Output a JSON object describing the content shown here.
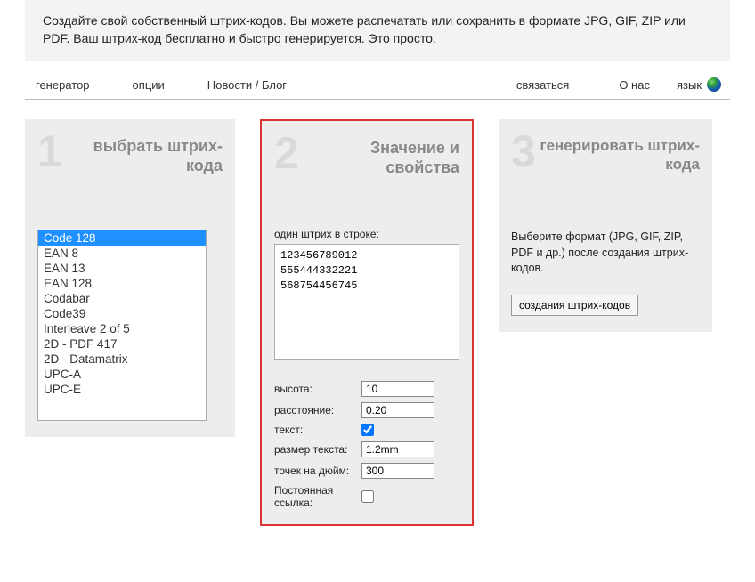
{
  "intro": "Создайте свой собственный штрих-кодов. Вы можете распечатать или сохранить в формате JPG, GIF, ZIP или PDF. Ваш штрих-код бесплатно и быстро генерируется. Это просто.",
  "nav": {
    "generator": "генератор",
    "options": "опции",
    "news": "Новости / Блог",
    "contact": "связаться",
    "about": "О нас",
    "language": "язык"
  },
  "panel1": {
    "num": "1",
    "title": "выбрать штрих-кода",
    "items": [
      "Code 128",
      "EAN 8",
      "EAN 13",
      "EAN 128",
      "Codabar",
      "Code39",
      "Interleave 2 of 5",
      "2D - PDF 417",
      "2D - Datamatrix",
      "UPC-A",
      "UPC-E"
    ],
    "selected_index": 0
  },
  "panel2": {
    "num": "2",
    "title": "Значение и свойства",
    "textarea_label": "один штрих в строке:",
    "textarea_value": "123456789012\n555444332221\n568754456745",
    "props": {
      "height_label": "высота:",
      "height_value": "10",
      "distance_label": "расстояние:",
      "distance_value": "0.20",
      "text_label": "текст:",
      "text_checked": true,
      "textsize_label": "размер текста:",
      "textsize_value": "1.2mm",
      "dpi_label": "точек на дюйм:",
      "dpi_value": "300",
      "permalink_label": "Постоянная ссылка:",
      "permalink_checked": false
    }
  },
  "panel3": {
    "num": "3",
    "title": "генерировать штрих-кода",
    "desc": "Выберите формат (JPG, GIF, ZIP, PDF и др.) после создания штрих-кодов.",
    "button": "создания штрих-кодов"
  }
}
